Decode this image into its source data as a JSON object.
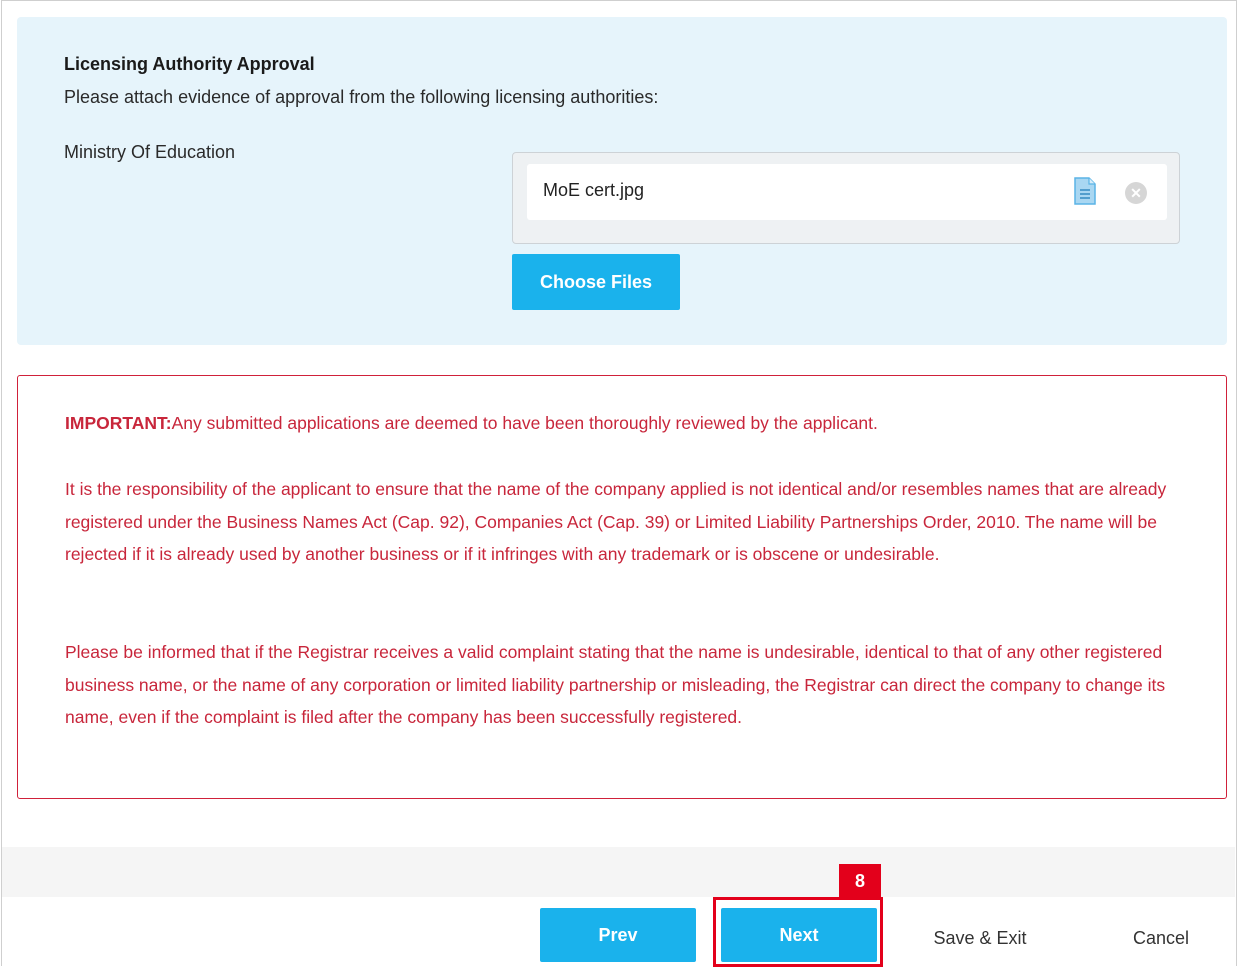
{
  "approval": {
    "title": "Licensing Authority Approval",
    "description": "Please attach evidence of approval from the following licensing authorities:",
    "authority": "Ministry Of Education",
    "file_name": "MoE cert.jpg",
    "choose_files_label": "Choose Files",
    "doc_icon": "document-icon",
    "remove_icon": "remove-file-icon"
  },
  "important": {
    "label": "IMPORTANT:",
    "line1": "Any submitted applications are deemed to have been thoroughly reviewed by the applicant.",
    "para2": "It is the responsibility of the applicant to ensure that the name of the company applied is not identical and/or resembles names that are already registered under the Business Names Act (Cap. 92), Companies Act (Cap. 39) or Limited Liability Partnerships Order, 2010. The name will be rejected if it is already used by another business or if it infringes with any trademark or is obscene or undesirable.",
    "para3": "Please be informed that if the Registrar receives a valid complaint stating that the name is undesirable, identical to that of any other registered business name, or the name of any corporation or limited liability partnership or misleading, the Registrar can direct the company to change its name, even if the complaint is filed after the company has been successfully registered."
  },
  "footer": {
    "prev_label": "Prev",
    "next_label": "Next",
    "save_exit_label": "Save & Exit",
    "cancel_label": "Cancel",
    "step_badge": "8"
  },
  "colors": {
    "accent": "#1ab2ec",
    "panel_bg": "#e6f4fb",
    "warning": "#c8263b",
    "highlight": "#e3001b"
  }
}
